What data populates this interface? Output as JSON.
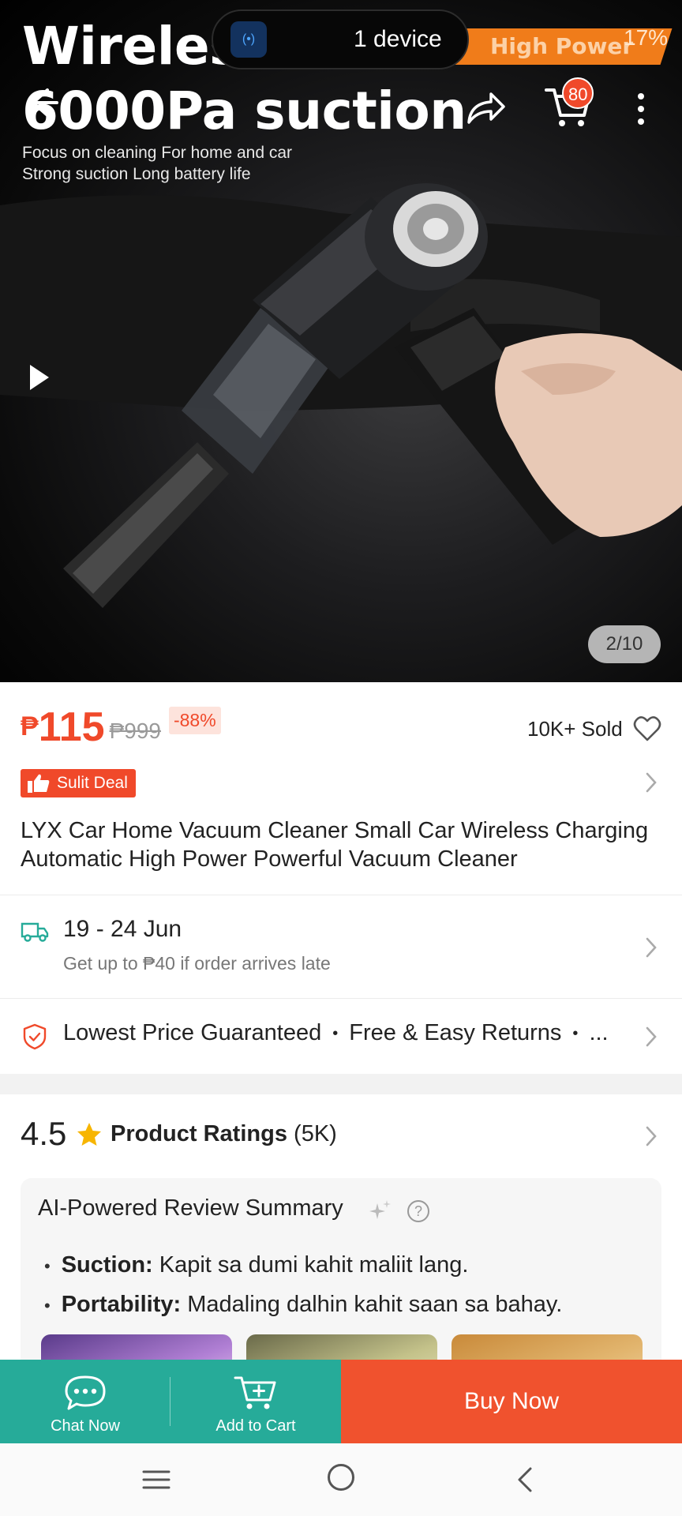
{
  "status_bar": {
    "device_pill_app": "(•)",
    "device_pill_text": "1 device",
    "battery": "17%"
  },
  "hero": {
    "title_line1": "Wireless",
    "title_line2": "6000Pa suction",
    "subtitle_line1": "Focus on cleaning  For home and car",
    "subtitle_line2": "Strong suction  Long battery life",
    "banner_text": "High Power",
    "image_counter": "2/10"
  },
  "header": {
    "cart_count": "80"
  },
  "product": {
    "currency": "₱",
    "price": "115",
    "old_price": "₱999",
    "discount": "-88%",
    "sold": "10K+ Sold",
    "deal_label": "Sulit Deal",
    "title": "LYX Car Home Vacuum Cleaner Small Car Wireless Charging Automatic High Power Powerful Vacuum Cleaner"
  },
  "delivery": {
    "date": "19 - 24 Jun",
    "note": "Get up to ₱40 if order arrives late"
  },
  "guarantee": {
    "item1": "Lowest Price Guaranteed",
    "item2": "Free & Easy Returns",
    "more": "..."
  },
  "ratings": {
    "score": "4.5",
    "label": "Product Ratings",
    "count": "(5K)"
  },
  "ai_summary": {
    "title": "AI-Powered Review Summary",
    "help": "?",
    "points": [
      {
        "key": "Suction:",
        "text": " Kapit sa dumi kahit maliit lang."
      },
      {
        "key": "Portability:",
        "text": " Madaling dalhin kahit saan sa bahay."
      }
    ]
  },
  "action_bar": {
    "chat_label": "Chat Now",
    "cart_label": "Add to Cart",
    "buy_label": "Buy Now"
  },
  "colors": {
    "accent_orange": "#f0492a",
    "teal": "#26ab99"
  }
}
